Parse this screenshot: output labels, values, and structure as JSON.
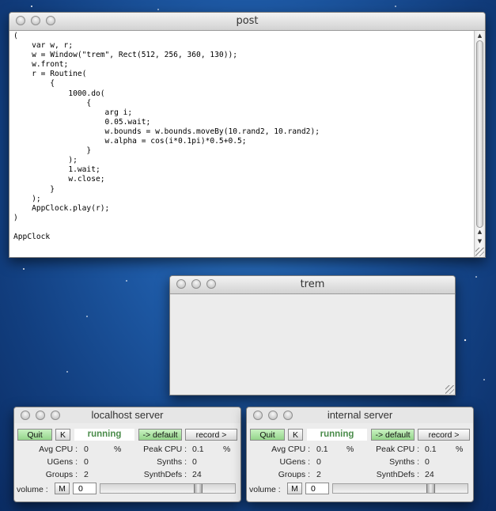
{
  "post_window": {
    "title": "post",
    "code": "(\n\tvar w, r;\n\tw = Window(\"trem\", Rect(512, 256, 360, 130));\n\tw.front;\n\tr = Routine(\n\t\t{\n\t\t\t1000.do(\n\t\t\t\t{\n\t\t\t\t\targ i;\n\t\t\t\t\t0.05.wait;\n\t\t\t\t\tw.bounds = w.bounds.moveBy(10.rand2, 10.rand2);\n\t\t\t\t\tw.alpha = cos(i*0.1pi)*0.5+0.5;\n\t\t\t\t}\n\t\t\t);\n\t\t\t1.wait;\n\t\t\tw.close;\n\t\t}\n\t);\n\tAppClock.play(r);\n)\n\nAppClock"
  },
  "trem_window": {
    "title": "trem"
  },
  "servers": [
    {
      "title": "localhost server",
      "quit_label": "Quit",
      "k_label": "K",
      "status": "running",
      "default_label": "-> default",
      "record_label": "record >",
      "avg_cpu_label": "Avg CPU :",
      "avg_cpu_value": "0",
      "avg_cpu_unit": "%",
      "peak_cpu_label": "Peak CPU :",
      "peak_cpu_value": "0.1",
      "peak_cpu_unit": "%",
      "ugens_label": "UGens :",
      "ugens_value": "0",
      "synths_label": "Synths :",
      "synths_value": "0",
      "groups_label": "Groups :",
      "groups_value": "2",
      "synthdefs_label": "SynthDefs :",
      "synthdefs_value": "24",
      "volume_label": "volume :",
      "mute_label": "M",
      "volume_value": "0",
      "volume_slider_fraction": 0.73
    },
    {
      "title": "internal server",
      "quit_label": "Quit",
      "k_label": "K",
      "status": "running",
      "default_label": "-> default",
      "record_label": "record >",
      "avg_cpu_label": "Avg CPU :",
      "avg_cpu_value": "0.1",
      "avg_cpu_unit": "%",
      "peak_cpu_label": "Peak CPU :",
      "peak_cpu_value": "0.1",
      "peak_cpu_unit": "%",
      "ugens_label": "UGens :",
      "ugens_value": "0",
      "synths_label": "Synths :",
      "synths_value": "0",
      "groups_label": "Groups :",
      "groups_value": "2",
      "synthdefs_label": "SynthDefs :",
      "synthdefs_value": "24",
      "volume_label": "volume :",
      "mute_label": "M",
      "volume_value": "0",
      "volume_slider_fraction": 0.73
    }
  ]
}
